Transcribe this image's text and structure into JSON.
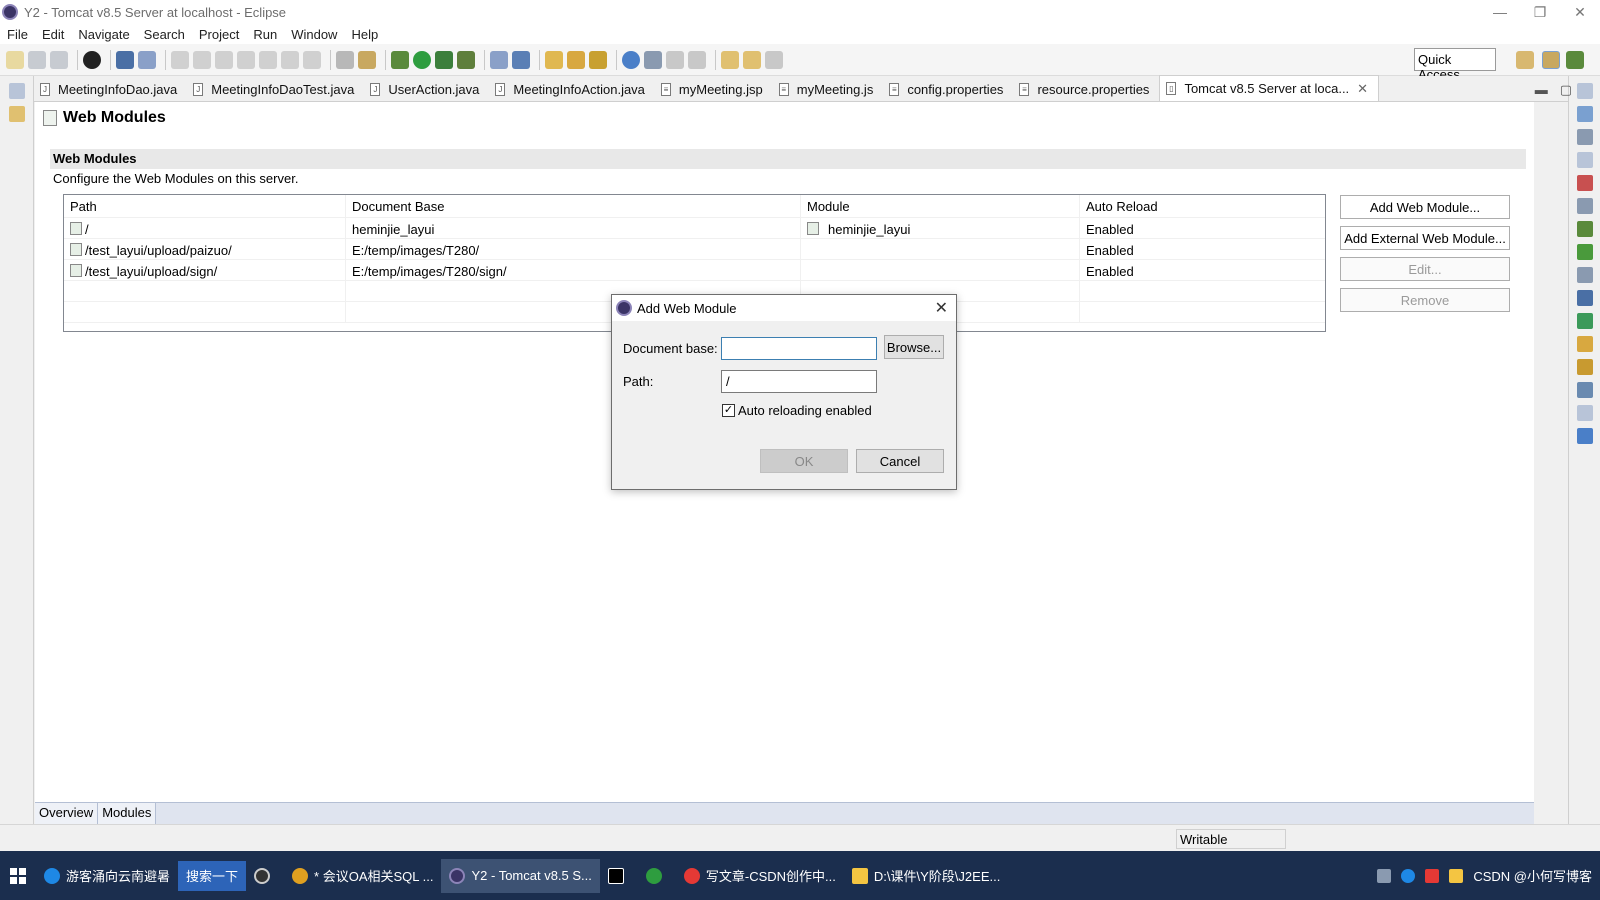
{
  "window": {
    "title": "Y2 - Tomcat v8.5 Server at localhost - Eclipse",
    "min": "—",
    "max": "❐",
    "close": "✕"
  },
  "menu": [
    "File",
    "Edit",
    "Navigate",
    "Search",
    "Project",
    "Run",
    "Window",
    "Help"
  ],
  "toolbar": {
    "quick_access": "Quick Access"
  },
  "tabs": [
    {
      "label": "MeetingInfoDao.java",
      "icon": "J"
    },
    {
      "label": "MeetingInfoDaoTest.java",
      "icon": "J"
    },
    {
      "label": "UserAction.java",
      "icon": "J"
    },
    {
      "label": "MeetingInfoAction.java",
      "icon": "J"
    },
    {
      "label": "myMeeting.jsp",
      "icon": "≡"
    },
    {
      "label": "myMeeting.js",
      "icon": "≡"
    },
    {
      "label": "config.properties",
      "icon": "≡"
    },
    {
      "label": "resource.properties",
      "icon": "≡"
    },
    {
      "label": "Tomcat v8.5 Server at loca...",
      "icon": "▯",
      "active": true,
      "close": "✕"
    }
  ],
  "editor": {
    "title": "Web Modules",
    "section_title": "Web Modules",
    "section_desc": "Configure the Web Modules on this server.",
    "columns": [
      "Path",
      "Document Base",
      "Module",
      "Auto Reload"
    ],
    "rows": [
      {
        "path": "/",
        "doc_base": "heminjie_layui",
        "module": "heminjie_layui",
        "auto_reload": "Enabled"
      },
      {
        "path": "/test_layui/upload/paizuo/",
        "doc_base": "E:/temp/images/T280/",
        "module": "",
        "auto_reload": "Enabled"
      },
      {
        "path": "/test_layui/upload/sign/",
        "doc_base": "E:/temp/images/T280/sign/",
        "module": "",
        "auto_reload": "Enabled"
      }
    ],
    "buttons": {
      "add": "Add Web Module...",
      "add_external": "Add External Web Module...",
      "edit": "Edit...",
      "remove": "Remove"
    },
    "page_tabs": [
      "Overview",
      "Modules"
    ]
  },
  "status": {
    "writable": "Writable"
  },
  "dialog": {
    "title": "Add Web Module",
    "doc_base_label": "Document base:",
    "doc_base_value": "",
    "browse": "Browse...",
    "path_label": "Path:",
    "path_value": "/",
    "auto_reload_label": "Auto reloading enabled",
    "auto_reload_checked": true,
    "ok": "OK",
    "cancel": "Cancel",
    "close": "✕"
  },
  "taskbar": {
    "items": [
      {
        "label": "游客涌向云南避暑",
        "color": "#1e88e5"
      },
      {
        "label": "搜索一下",
        "search": true
      },
      {
        "label": "",
        "color": "#333"
      },
      {
        "label": "* 会议OA相关SQL ...",
        "color": "#e0a020"
      },
      {
        "label": "Y2 - Tomcat v8.5 S...",
        "color": "#3b3466",
        "active": true
      },
      {
        "label": "",
        "color": "#000"
      },
      {
        "label": "",
        "color": "#2e9d3f"
      },
      {
        "label": "写文章-CSDN创作中...",
        "color": "#e53935"
      },
      {
        "label": "D:\\课件\\Y阶段\\J2EE...",
        "color": "#f4c542"
      }
    ],
    "tray_text": "CSDN @小何写博客"
  }
}
